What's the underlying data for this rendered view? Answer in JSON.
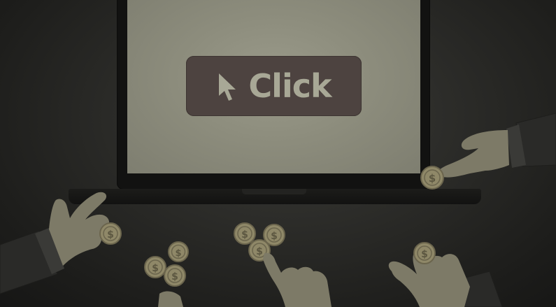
{
  "scene": {
    "button_label": "Click",
    "coin_symbol": "$",
    "icons": [
      "cursor-arrow-icon",
      "dollar-coin-icon",
      "pointing-hand-icon",
      "cuffed-hand-icon"
    ],
    "colors": {
      "background": "#232321",
      "screen": "#8d8d7d",
      "button": "#4d4340",
      "button_text": "#a8a896",
      "coin": "#8f8868",
      "hand": "#7d7a67",
      "sleeve": "#2a2a28"
    }
  }
}
